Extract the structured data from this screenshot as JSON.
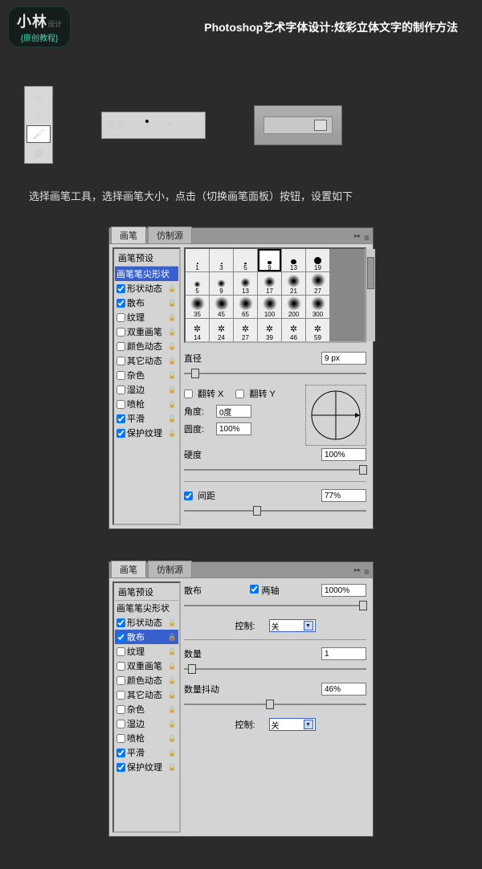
{
  "logo": {
    "main": "小林",
    "side": "设计",
    "sub": "{原创教程}"
  },
  "page_title": "Photoshop艺术字体设计:炫彩立体文字的制作方法",
  "brush_size": {
    "label": "画笔:",
    "value": "9"
  },
  "instruction": "选择画笔工具，选择画笔大小，点击（切换画笔面板）按钮，设置如下",
  "panel1": {
    "tabs": [
      "画笔",
      "仿制源"
    ],
    "preset_header": "画笔预设",
    "options": [
      {
        "label": "画笔笔尖形状",
        "checked": null,
        "selected": true
      },
      {
        "label": "形状动态",
        "checked": true,
        "lock": true
      },
      {
        "label": "散布",
        "checked": true,
        "lock": true
      },
      {
        "label": "纹理",
        "checked": false,
        "lock": true
      },
      {
        "label": "双重画笔",
        "checked": false,
        "lock": true
      },
      {
        "label": "颜色动态",
        "checked": false,
        "lock": true
      },
      {
        "label": "其它动态",
        "checked": false,
        "lock": true
      },
      {
        "label": "杂色",
        "checked": false,
        "lock": true
      },
      {
        "label": "湿边",
        "checked": false,
        "lock": true
      },
      {
        "label": "喷枪",
        "checked": false,
        "lock": true
      },
      {
        "label": "平滑",
        "checked": true,
        "lock": true
      },
      {
        "label": "保护纹理",
        "checked": true,
        "lock": true
      }
    ],
    "swatches": [
      [
        "1",
        "3",
        "5",
        "9",
        "13",
        "19"
      ],
      [
        "5",
        "9",
        "13",
        "17",
        "21",
        "27"
      ],
      [
        "35",
        "45",
        "65",
        "100",
        "200",
        "300"
      ],
      [
        "14",
        "24",
        "27",
        "39",
        "46",
        "59"
      ]
    ],
    "sel_index": 3,
    "diameter": {
      "label": "直径",
      "value": "9 px"
    },
    "flipx": "翻转 X",
    "flipy": "翻转 Y",
    "angle": {
      "label": "角度:",
      "value": "0度"
    },
    "round": {
      "label": "圆度:",
      "value": "100%"
    },
    "hardness": {
      "label": "硬度",
      "value": "100%"
    },
    "spacing": {
      "label": "间距",
      "checked": true,
      "value": "77%"
    }
  },
  "panel2": {
    "tabs": [
      "画笔",
      "仿制源"
    ],
    "preset_header": "画笔预设",
    "options": [
      {
        "label": "画笔笔尖形状",
        "checked": null
      },
      {
        "label": "形状动态",
        "checked": true,
        "lock": true
      },
      {
        "label": "散布",
        "checked": true,
        "selected": true,
        "lock": true
      },
      {
        "label": "纹理",
        "checked": false,
        "lock": true
      },
      {
        "label": "双重画笔",
        "checked": false,
        "lock": true
      },
      {
        "label": "颜色动态",
        "checked": false,
        "lock": true
      },
      {
        "label": "其它动态",
        "checked": false,
        "lock": true
      },
      {
        "label": "杂色",
        "checked": false,
        "lock": true
      },
      {
        "label": "湿边",
        "checked": false,
        "lock": true
      },
      {
        "label": "喷枪",
        "checked": false,
        "lock": true
      },
      {
        "label": "平滑",
        "checked": true,
        "lock": true
      },
      {
        "label": "保护纹理",
        "checked": true,
        "lock": true
      }
    ],
    "scatter": {
      "label": "散布",
      "both": "两轴",
      "both_checked": true,
      "value": "1000%"
    },
    "control": {
      "label": "控制:",
      "value": "关"
    },
    "count": {
      "label": "数量",
      "value": "1"
    },
    "jitter": {
      "label": "数量抖动",
      "value": "46%"
    },
    "control2": {
      "label": "控制:",
      "value": "关"
    }
  }
}
